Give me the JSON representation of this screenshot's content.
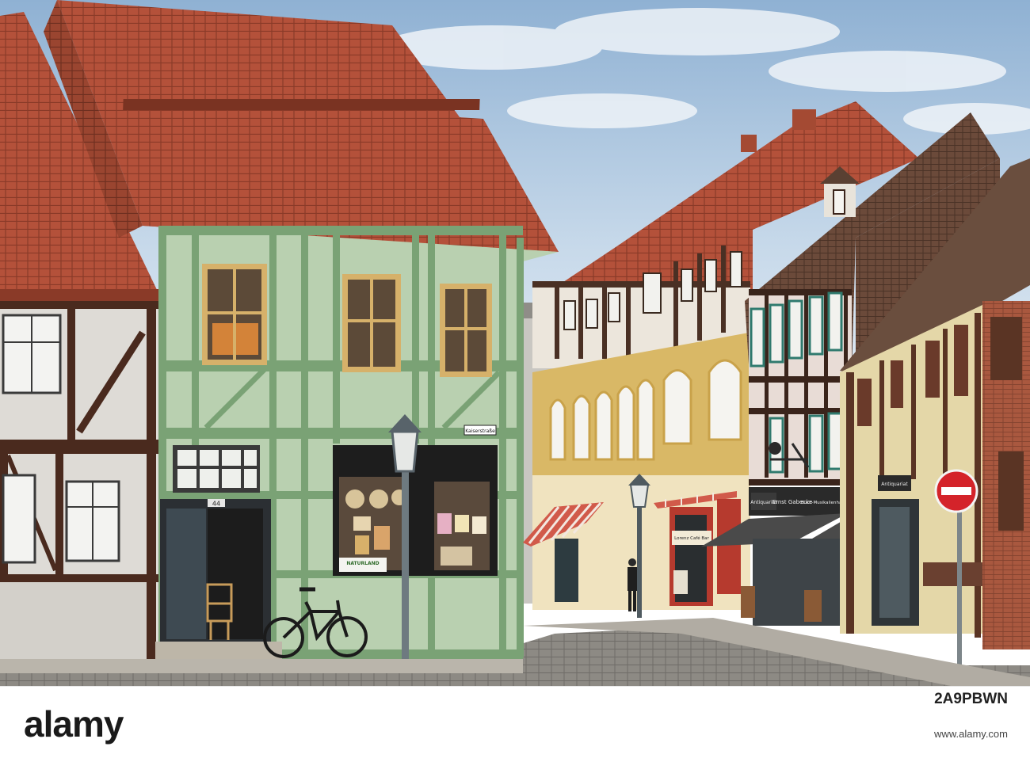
{
  "scene": {
    "signs": {
      "street": "Kaiserstraße",
      "house_number": "44",
      "naturland": "NATURLAND",
      "antiquariat": "Antiquariat",
      "shop_name": "Ernst Gabecke",
      "bookshop": "Buch-Musikalienhandlung",
      "antiquariat_right": "Antiquariat",
      "cafe": "Lorenz Café Bar"
    },
    "colors": {
      "sky": "#9dbcd9",
      "roof": "#b9533a",
      "green_facade": "#b7cfae",
      "green_timber": "#7fa57a",
      "yellow_facade": "#d9b866",
      "cream_facade": "#e2d3a8",
      "cobblestone": "#8a8782",
      "no_entry_sign": "#d4232a"
    }
  },
  "footer": {
    "brand": "alamy",
    "image_code": "2A9PBWN",
    "site": "www.alamy.com"
  }
}
